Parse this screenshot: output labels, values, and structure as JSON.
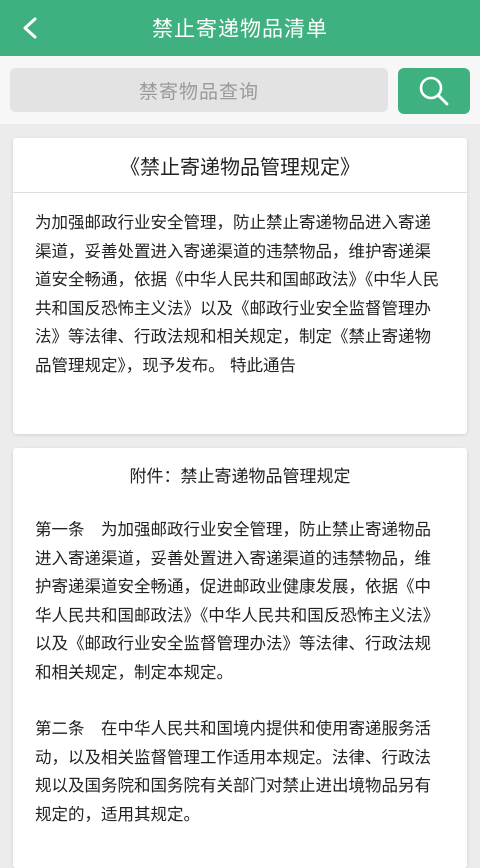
{
  "header": {
    "title": "禁止寄递物品清单",
    "back_icon": "chevron-left-icon"
  },
  "search": {
    "placeholder": "禁寄物品查询",
    "button_icon": "search-icon"
  },
  "notice": {
    "title": "《禁止寄递物品管理规定》",
    "body": "为加强邮政行业安全管理，防止禁止寄递物品进入寄递渠道，妥善处置进入寄递渠道的违禁物品，维护寄递渠道安全畅通，依据《中华人民共和国邮政法》《中华人民共和国反恐怖主义法》以及《邮政行业安全监督管理办法》等法律、行政法规和相关规定，制定《禁止寄递物品管理规定》，现予发布。 特此通告"
  },
  "attachment": {
    "title": "附件：禁止寄递物品管理规定",
    "articles": [
      "第一条　为加强邮政行业安全管理，防止禁止寄递物品进入寄递渠道，妥善处置进入寄递渠道的违禁物品，维护寄递渠道安全畅通，促进邮政业健康发展，依据《中华人民共和国邮政法》《中华人民共和国反恐怖主义法》以及《邮政行业安全监督管理办法》等法律、行政法规和相关规定，制定本规定。",
      "第二条　在中华人民共和国境内提供和使用寄递服务活动，以及相关监督管理工作适用本规定。法律、行政法规以及国务院和国务院有关部门对禁止进出境物品另有规定的，适用其规定。"
    ]
  },
  "colors": {
    "accent": "#3fb07f",
    "background": "#ececec"
  }
}
